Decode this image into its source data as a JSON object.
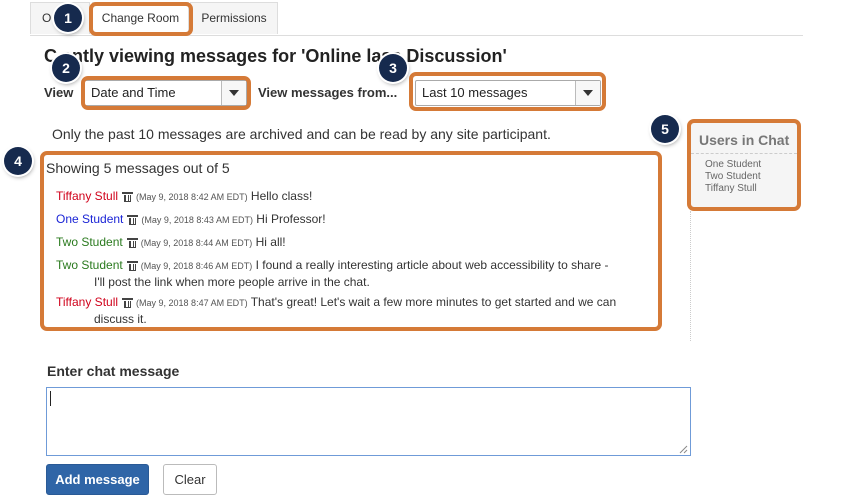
{
  "tabs": [
    {
      "label": "O"
    },
    {
      "label": "Change Room"
    },
    {
      "label": "Permissions"
    }
  ],
  "page_title": "C      ently viewing messages for 'Online  lass Discussion'",
  "view": {
    "label": "View",
    "selected": "Date and Time"
  },
  "view_from": {
    "label": "View messages from...",
    "selected": "Last 10 messages"
  },
  "archive_note": "Only the past 10 messages are archived and can be read by any site participant.",
  "messages_panel": {
    "showing": "Showing 5 messages out of 5",
    "messages": [
      {
        "name": "Tiffany Stull",
        "color": "#d0021b",
        "time": "(May 9, 2018 8:42 AM EDT)",
        "text": "Hello class!",
        "cont": ""
      },
      {
        "name": "One Student",
        "color": "#1a24d6",
        "time": "(May 9, 2018 8:43 AM EDT)",
        "text": "Hi Professor!",
        "cont": ""
      },
      {
        "name": "Two Student",
        "color": "#2a7a1e",
        "time": "(May 9, 2018 8:44 AM EDT)",
        "text": "Hi all!",
        "cont": ""
      },
      {
        "name": "Two Student",
        "color": "#2a7a1e",
        "time": "(May 9, 2018 8:46 AM EDT)",
        "text": "I found a really interesting article about web accessibility to share -",
        "cont": "I'll post the link when more people arrive in the chat."
      },
      {
        "name": "Tiffany Stull",
        "color": "#d0021b",
        "time": "(May 9, 2018 8:47 AM EDT)",
        "text": "That's great! Let's wait a few more minutes to get started and we can",
        "cont": "discuss it."
      }
    ]
  },
  "users_in_chat": {
    "title": "Users in Chat",
    "users": [
      "One Student",
      "Two Student",
      "Tiffany Stull"
    ]
  },
  "chat_input": {
    "label": "Enter chat message",
    "value": ""
  },
  "buttons": {
    "add": "Add message",
    "clear": "Clear"
  },
  "callouts": [
    "1",
    "2",
    "3",
    "4",
    "5"
  ],
  "colors": {
    "highlight": "#d57a37",
    "badge": "#162a4e",
    "primary_button": "#2f65a7"
  }
}
